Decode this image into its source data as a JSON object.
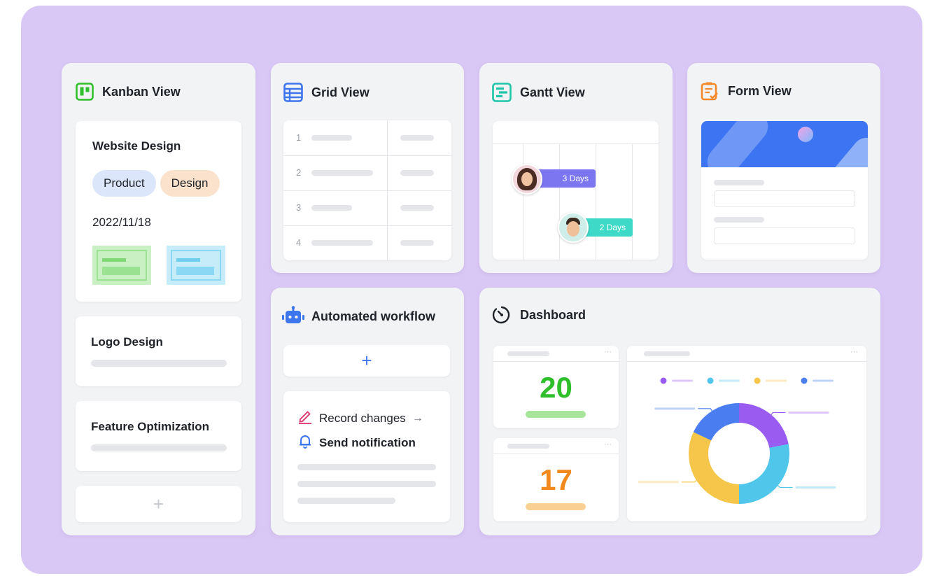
{
  "kanban": {
    "title": "Kanban View",
    "card1": {
      "title": "Website Design",
      "tags": [
        "Product",
        "Design"
      ],
      "date": "2022/11/18"
    },
    "card2": {
      "title": "Logo Design"
    },
    "card3": {
      "title": "Feature Optimization"
    },
    "add_symbol": "+"
  },
  "grid": {
    "title": "Grid View",
    "rows": [
      "1",
      "2",
      "3",
      "4"
    ]
  },
  "gantt": {
    "title": "Gantt View",
    "bars": [
      "3 Days",
      "2 Days"
    ]
  },
  "form": {
    "title": "Form View"
  },
  "workflow": {
    "title": "Automated workflow",
    "add_symbol": "+",
    "step1": "Record changes",
    "step1_arrow": "→",
    "step2": "Send notification"
  },
  "dashboard": {
    "title": "Dashboard",
    "stat1": {
      "value": "20",
      "color": "#2fbf2a"
    },
    "stat2": {
      "value": "17",
      "color": "#f2891c"
    },
    "legend_colors": [
      "#9a5cf0",
      "#4fc6ea",
      "#f5c64a",
      "#4a7ef0"
    ]
  },
  "chart_data": {
    "type": "pie",
    "style": "donut",
    "values": [
      22,
      28,
      32,
      18
    ],
    "colors": [
      "#9a5cf0",
      "#4fc6ea",
      "#f5c64a",
      "#4a7ef0"
    ]
  }
}
